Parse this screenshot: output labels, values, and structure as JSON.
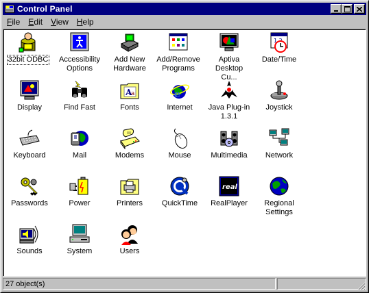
{
  "window": {
    "title": "Control Panel",
    "buttons": [
      "minimize",
      "maximize",
      "close"
    ]
  },
  "menu": [
    {
      "label": "File"
    },
    {
      "label": "Edit"
    },
    {
      "label": "View"
    },
    {
      "label": "Help"
    }
  ],
  "items": [
    {
      "label": "32bit ODBC",
      "icon": "odbc-icon"
    },
    {
      "label": "Accessibility Options",
      "icon": "accessibility-icon"
    },
    {
      "label": "Add New Hardware",
      "icon": "add-hardware-icon"
    },
    {
      "label": "Add/Remove Programs",
      "icon": "add-remove-programs-icon"
    },
    {
      "label": "Aptiva Desktop Cu...",
      "icon": "aptiva-icon"
    },
    {
      "label": "Date/Time",
      "icon": "date-time-icon"
    },
    {
      "label": "Display",
      "icon": "display-icon"
    },
    {
      "label": "Find Fast",
      "icon": "find-fast-icon"
    },
    {
      "label": "Fonts",
      "icon": "fonts-icon"
    },
    {
      "label": "Internet",
      "icon": "internet-icon"
    },
    {
      "label": "Java Plug-in 1.3.1",
      "icon": "java-icon"
    },
    {
      "label": "Joystick",
      "icon": "joystick-icon"
    },
    {
      "label": "Keyboard",
      "icon": "keyboard-icon"
    },
    {
      "label": "Mail",
      "icon": "mail-icon"
    },
    {
      "label": "Modems",
      "icon": "modem-icon"
    },
    {
      "label": "Mouse",
      "icon": "mouse-icon"
    },
    {
      "label": "Multimedia",
      "icon": "multimedia-icon"
    },
    {
      "label": "Network",
      "icon": "network-icon"
    },
    {
      "label": "Passwords",
      "icon": "passwords-icon"
    },
    {
      "label": "Power",
      "icon": "power-icon"
    },
    {
      "label": "Printers",
      "icon": "printers-icon"
    },
    {
      "label": "QuickTime",
      "icon": "quicktime-icon"
    },
    {
      "label": "RealPlayer",
      "icon": "realplayer-icon"
    },
    {
      "label": "Regional Settings",
      "icon": "regional-settings-icon"
    },
    {
      "label": "Sounds",
      "icon": "sounds-icon"
    },
    {
      "label": "System",
      "icon": "system-icon"
    },
    {
      "label": "Users",
      "icon": "users-icon"
    }
  ],
  "status": {
    "count_text": "27 object(s)"
  },
  "colors": {
    "titlebar": "#000080",
    "window_face": "#c0c0c0",
    "content_bg": "#ffffff"
  }
}
